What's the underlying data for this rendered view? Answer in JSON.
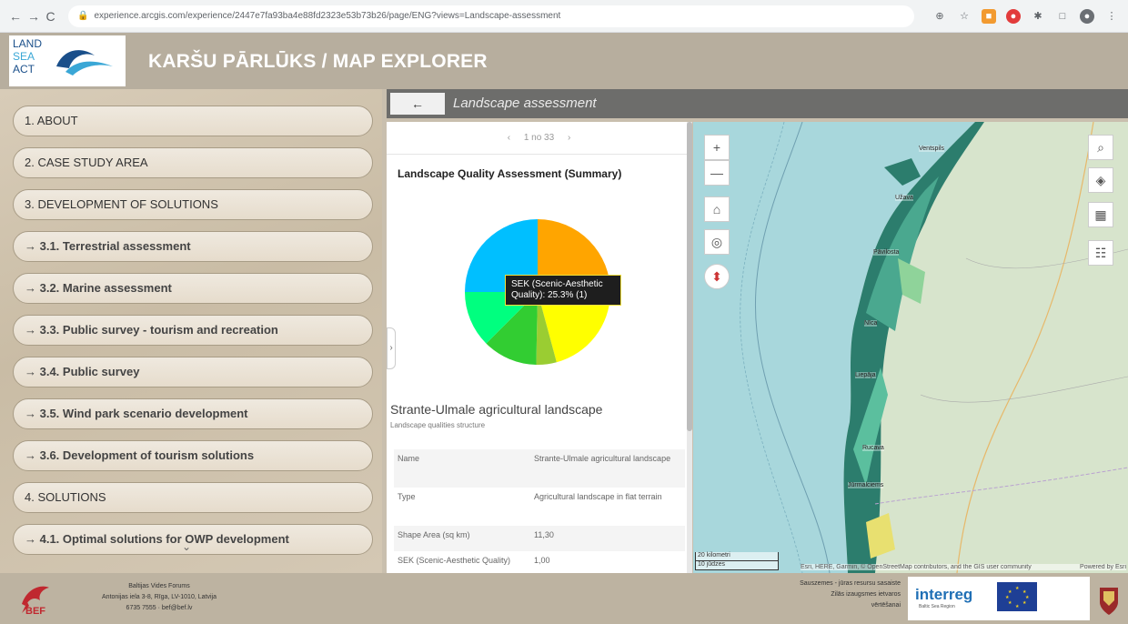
{
  "browser": {
    "url": "experience.arcgis.com/experience/2447e7fa93ba4e88fd2323e53b73b26/page/ENG?views=Landscape-assessment",
    "back": "←",
    "forward": "→",
    "reload": "C"
  },
  "header": {
    "logo_lines": [
      "LAND",
      "SEA",
      "ACT"
    ],
    "title": "KARŠU PĀRLŪKS / MAP EXPLORER"
  },
  "sidebar": {
    "items": [
      {
        "label": "1. ABOUT"
      },
      {
        "label": "2. CASE STUDY AREA"
      },
      {
        "label": "3. DEVELOPMENT OF SOLUTIONS"
      },
      {
        "label": "→ 3.1. Terrestrial assessment"
      },
      {
        "label": "→ 3.2. Marine assessment"
      },
      {
        "label": "→ 3.3. Public survey - tourism and recreation"
      },
      {
        "label": "→ 3.4. Public survey"
      },
      {
        "label": "→ 3.5. Wind park scenario development"
      },
      {
        "label": "→ 3.6. Development of tourism solutions"
      },
      {
        "label": "4. SOLUTIONS"
      },
      {
        "label": "→ 4.1. Optimal solutions for OWP development"
      }
    ],
    "scroll_indicator": "⌄"
  },
  "panel": {
    "back_label": "←",
    "title": "Landscape assessment",
    "pager": {
      "prev": "‹",
      "text": "1 no 33",
      "next": "›"
    },
    "summary_title": "Landscape Quality Assessment (Summary)",
    "tooltip": "SEK (Scenic-Aesthetic Quality): 25.3% (1)",
    "feature_title": "Strante-Ulmale agricultural landscape",
    "feature_subtitle": "Landscape qualities structure",
    "attributes": [
      {
        "key": "Name",
        "value": "Strante-Ulmale agricultural landscape"
      },
      {
        "key": "Type",
        "value": "Agricultural landscape in flat terrain"
      },
      {
        "key": "Shape Area (sq km)",
        "value": "11,30"
      },
      {
        "key": "SEK (Scenic-Aesthetic Quality)",
        "value": "1,00"
      }
    ],
    "collapse": "›"
  },
  "chart_data": {
    "type": "pie",
    "title": "Landscape Quality Assessment (Summary)",
    "slices": [
      {
        "label": "SEK (Scenic-Aesthetic Quality)",
        "percent": 25.3,
        "value": 1,
        "color": "#ffa500"
      },
      {
        "label": "",
        "percent": 20.5,
        "color": "#ffff00"
      },
      {
        "label": "",
        "percent": 4.5,
        "color": "#9acd32"
      },
      {
        "label": "",
        "percent": 12.2,
        "color": "#32cd32"
      },
      {
        "label": "",
        "percent": 12.5,
        "color": "#00ff7f"
      },
      {
        "label": "",
        "percent": 25.0,
        "color": "#00bfff"
      }
    ]
  },
  "map": {
    "zoom_in": "+",
    "zoom_out": "—",
    "home": "⌂",
    "locate": "◎",
    "compass": "⬍",
    "tools": [
      "search-icon",
      "layers-icon",
      "basemap-icon",
      "legend-icon"
    ],
    "scale_km": "20 kilometri",
    "scale_mi": "10 jūdzes",
    "attribution": "Esri, HERE, Garmin, © OpenStreetMap contributors, and the GIS user community",
    "powered_by": "Powered by Esri",
    "places": [
      "Ventspils",
      "Užava",
      "Pāvilosta",
      "Liepāja",
      "Nīca",
      "Rucava",
      "Jūrmalciems"
    ]
  },
  "footer": {
    "org": "Baltijas Vides Forums",
    "address": "Antonijas iela 3-8, Rīga, LV-1010, Latvija",
    "contact": "6735 7555 · bef@bef.lv",
    "bef_logo": "BEF",
    "project_line1": "Sauszemes - jūras resursu sasaiste",
    "project_line2": "Zilās izaugsmes ietvaros",
    "project_line3": "vērtēšanai",
    "interreg": "interreg",
    "interreg_sub": "Baltic Sea Region"
  },
  "colors": {
    "header_bg": "#b7ae9e",
    "panel_head_bg": "#6d6d6b",
    "sea": "#a8d7dc",
    "land": "#d7e4cc",
    "landscape_dark": "#2c7d6d",
    "bef_red": "#c0282f"
  }
}
